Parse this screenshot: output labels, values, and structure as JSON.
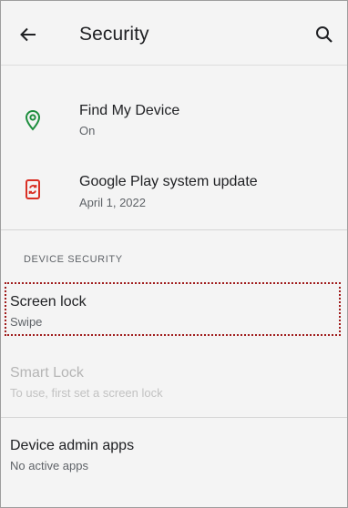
{
  "header": {
    "title": "Security",
    "back_icon": "arrow-back-icon",
    "search_icon": "search-icon"
  },
  "items": {
    "find_my_device": {
      "label": "Find My Device",
      "sub": "On",
      "icon": "location-pin-icon",
      "icon_color": "#1e8e3e"
    },
    "play_update": {
      "label": "Google Play system update",
      "sub": "April 1, 2022",
      "icon": "system-update-icon",
      "icon_color": "#d93025"
    }
  },
  "section": {
    "heading": "DEVICE SECURITY"
  },
  "device_security": {
    "screen_lock": {
      "label": "Screen lock",
      "sub": "Swipe"
    },
    "smart_lock": {
      "label": "Smart Lock",
      "sub": "To use, first set a screen lock"
    },
    "device_admin": {
      "label": "Device admin apps",
      "sub": "No active apps"
    }
  },
  "colors": {
    "background": "#f4f4f4",
    "highlight_border": "#a01c1c",
    "disabled_text": "#b5b5b5"
  }
}
